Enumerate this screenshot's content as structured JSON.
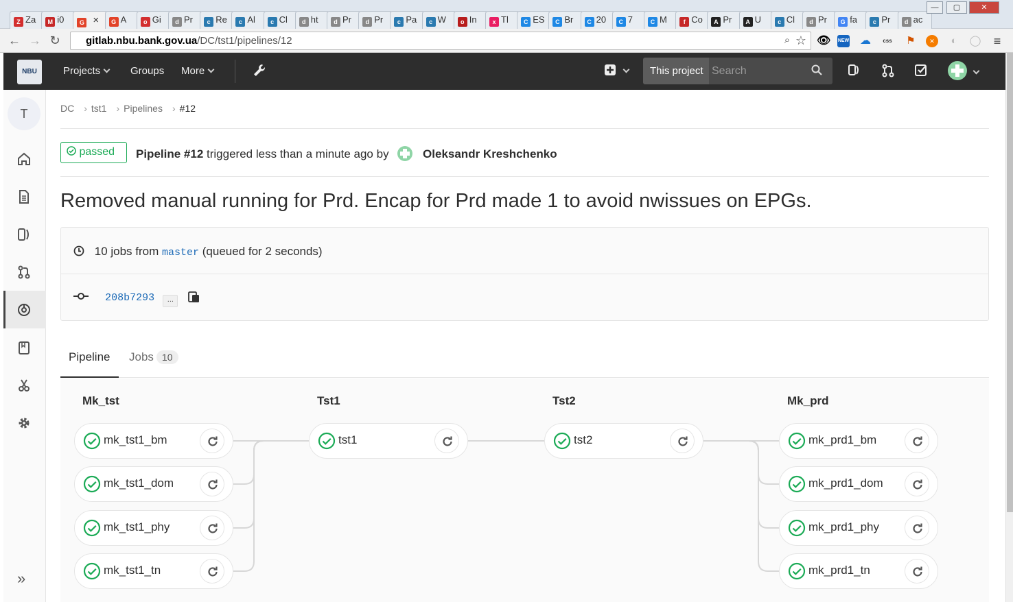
{
  "browser": {
    "tabs": [
      {
        "label": "Za",
        "fav": "Z",
        "color": "#d32f2f"
      },
      {
        "label": "i0",
        "fav": "M",
        "color": "#c62828"
      },
      {
        "label": "",
        "fav": "G",
        "color": "#e24329",
        "active": true
      },
      {
        "label": "A",
        "fav": "G",
        "color": "#e24329"
      },
      {
        "label": "Gi",
        "fav": "o",
        "color": "#d32f2f"
      },
      {
        "label": "Pr",
        "fav": "d",
        "color": "#888"
      },
      {
        "label": "Re",
        "fav": "c",
        "color": "#2a7ab0"
      },
      {
        "label": "Al",
        "fav": "c",
        "color": "#2a7ab0"
      },
      {
        "label": "Cl",
        "fav": "c",
        "color": "#2a7ab0"
      },
      {
        "label": "ht",
        "fav": "d",
        "color": "#888"
      },
      {
        "label": "Pr",
        "fav": "d",
        "color": "#888"
      },
      {
        "label": "Pr",
        "fav": "d",
        "color": "#888"
      },
      {
        "label": "Pa",
        "fav": "c",
        "color": "#2a7ab0"
      },
      {
        "label": "W",
        "fav": "c",
        "color": "#2a7ab0"
      },
      {
        "label": "In",
        "fav": "o",
        "color": "#b71c1c"
      },
      {
        "label": "Tl",
        "fav": "x",
        "color": "#e91e63"
      },
      {
        "label": "ES",
        "fav": "C",
        "color": "#1e88e5"
      },
      {
        "label": "Br",
        "fav": "C",
        "color": "#1e88e5"
      },
      {
        "label": "20",
        "fav": "C",
        "color": "#1e88e5"
      },
      {
        "label": "7",
        "fav": "C",
        "color": "#1e88e5"
      },
      {
        "label": "M",
        "fav": "C",
        "color": "#1e88e5"
      },
      {
        "label": "Co",
        "fav": "f",
        "color": "#c62828"
      },
      {
        "label": "Pr",
        "fav": "A",
        "color": "#222"
      },
      {
        "label": "U",
        "fav": "A",
        "color": "#222"
      },
      {
        "label": "Cl",
        "fav": "c",
        "color": "#2a7ab0"
      },
      {
        "label": "Pr",
        "fav": "d",
        "color": "#888"
      },
      {
        "label": "fa",
        "fav": "G",
        "color": "#4285f4"
      },
      {
        "label": "Pr",
        "fav": "c",
        "color": "#2a7ab0"
      },
      {
        "label": "ac",
        "fav": "d",
        "color": "#888"
      }
    ],
    "url_host": "gitlab.nbu.bank.gov.ua",
    "url_path": "/DC/tst1/pipelines/12"
  },
  "header": {
    "logo_text": "NBU",
    "nav": [
      "Projects",
      "Groups",
      "More"
    ],
    "this_project": "This project",
    "search_placeholder": "Search"
  },
  "sidebar": {
    "avatar_letter": "T"
  },
  "breadcrumb": [
    "DC",
    "tst1",
    "Pipelines",
    "#12"
  ],
  "pipeline": {
    "status": "passed",
    "title_bold": "Pipeline #12",
    "triggered_text": "triggered less than a minute ago by",
    "user": "Oleksandr Kreshchenko",
    "commit_title": "Removed manual running for Prd. Encap for Prd made 1 to avoid nwissues on EPGs.",
    "jobs_text_pre": "10 jobs from",
    "branch": "master",
    "jobs_text_post": "(queued for 2 seconds)",
    "sha": "208b7293",
    "ellipsis": "..."
  },
  "tabs": {
    "pipeline": "Pipeline",
    "jobs": "Jobs",
    "jobs_count": "10"
  },
  "stages": [
    {
      "name": "Mk_tst",
      "jobs": [
        "mk_tst1_bm",
        "mk_tst1_dom",
        "mk_tst1_phy",
        "mk_tst1_tn"
      ]
    },
    {
      "name": "Tst1",
      "jobs": [
        "tst1"
      ]
    },
    {
      "name": "Tst2",
      "jobs": [
        "tst2"
      ]
    },
    {
      "name": "Mk_prd",
      "jobs": [
        "mk_prd1_bm",
        "mk_prd1_dom",
        "mk_prd1_phy",
        "mk_prd1_tn"
      ]
    }
  ],
  "colors": {
    "success": "#1aaa55",
    "link": "#1b69b6",
    "header_bg": "#2d2d2d"
  }
}
